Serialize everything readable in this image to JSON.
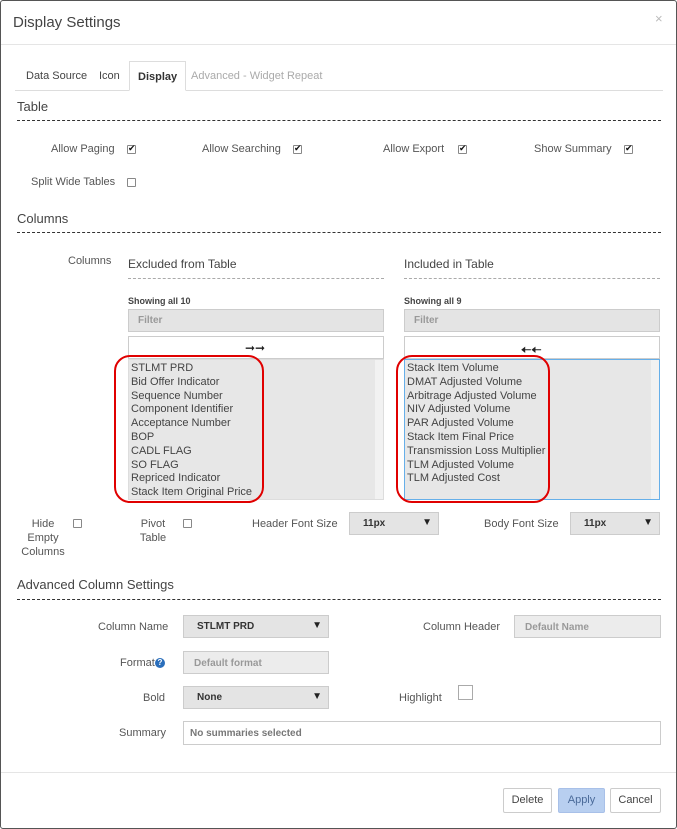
{
  "dialog": {
    "title": "Display Settings",
    "close_glyph": "×"
  },
  "tabs": [
    {
      "label": "Data Source"
    },
    {
      "label": "Icon"
    },
    {
      "label": "Display"
    },
    {
      "label": "Advanced - Widget Repeat"
    }
  ],
  "table_section": {
    "title": "Table",
    "options": [
      {
        "label": "Allow Paging",
        "checked": true
      },
      {
        "label": "Allow Searching",
        "checked": true
      },
      {
        "label": "Allow Export",
        "checked": true
      },
      {
        "label": "Show Summary",
        "checked": true
      },
      {
        "label": "Split Wide Tables",
        "checked": false
      }
    ]
  },
  "columns_section": {
    "title": "Columns",
    "label": "Columns",
    "excluded": {
      "title": "Excluded from Table",
      "count_text": "Showing all 10",
      "filter_placeholder": "Filter",
      "move_arrows": "➞➞",
      "items": [
        "STLMT PRD",
        "Bid Offer Indicator",
        "Sequence Number",
        "Component Identifier",
        "Acceptance Number",
        "BOP",
        "CADL FLAG",
        "SO FLAG",
        "Repriced Indicator",
        "Stack Item Original Price"
      ]
    },
    "included": {
      "title": "Included in Table",
      "count_text": "Showing all 9",
      "filter_placeholder": "Filter",
      "move_arrows": "🠠🠠",
      "items": [
        "Stack Item Volume",
        "DMAT Adjusted Volume",
        "Arbitrage Adjusted Volume",
        "NIV Adjusted Volume",
        "PAR Adjusted Volume",
        "Stack Item Final Price",
        "Transmission Loss Multiplier",
        "TLM Adjusted Volume",
        "TLM Adjusted Cost"
      ]
    },
    "hide_empty_label": "Hide Empty Columns",
    "pivot_label": "Pivot Table",
    "header_font_size_label": "Header Font Size",
    "header_font_size_value": "11px",
    "body_font_size_label": "Body Font Size",
    "body_font_size_value": "11px",
    "caret": "▼"
  },
  "advanced_section": {
    "title": "Advanced Column Settings",
    "column_name_label": "Column Name",
    "column_name_value": "STLMT PRD",
    "column_header_label": "Column Header",
    "column_header_placeholder": "Default Name",
    "format_label": "Format",
    "format_help": "?",
    "format_placeholder": "Default format",
    "bold_label": "Bold",
    "bold_value": "None",
    "highlight_label": "Highlight",
    "summary_label": "Summary",
    "summary_value": "No summaries selected"
  },
  "footer": {
    "delete_label": "Delete",
    "apply_label": "Apply",
    "cancel_label": "Cancel"
  },
  "colors": {
    "accent_selection": "#e00000",
    "apply_button": "#b8cff0",
    "focus_border": "#66afe9"
  }
}
